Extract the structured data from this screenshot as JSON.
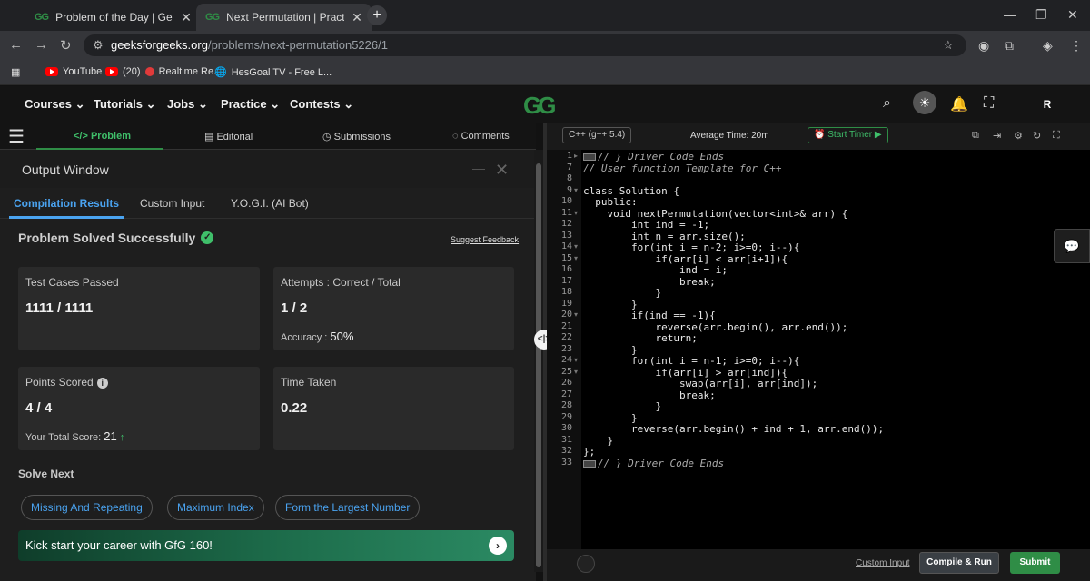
{
  "browser": {
    "tabs": [
      {
        "label": "Problem of the Day | GeeksforG",
        "favicon": "GG"
      },
      {
        "label": "Next Permutation | Practice | Ge",
        "favicon": "GG"
      }
    ],
    "new_tab": "+",
    "url_host": "geeksforgeeks.org",
    "url_path": "/problems/next-permutation5226/1",
    "bookmarks": [
      {
        "label": "YouTube"
      },
      {
        "label": "(20)"
      },
      {
        "label": "Realtime Re..."
      },
      {
        "label": "HesGoal TV - Free L..."
      }
    ]
  },
  "nav": {
    "items": [
      "Courses",
      "Tutorials",
      "Jobs",
      "Practice",
      "Contests"
    ],
    "logo": "GG",
    "avatar": "R"
  },
  "left_tabs": [
    "</> Problem",
    "Editorial",
    "Submissions",
    "Comments"
  ],
  "output": {
    "title": "Output Window",
    "tabs": [
      "Compilation Results",
      "Custom Input",
      "Y.O.G.I. (AI Bot)"
    ],
    "status": "Problem Solved Successfully",
    "feedback": "Suggest Feedback",
    "test_label": "Test Cases Passed",
    "test_value": "1111 / 1111",
    "attempts_label": "Attempts : Correct / Total",
    "attempts_value": "1 / 2",
    "accuracy_label": "Accuracy :",
    "accuracy_value": "50%",
    "points_label": "Points Scored",
    "points_value": "4 / 4",
    "total_label": "Your Total Score:",
    "total_value": "21",
    "time_label": "Time Taken",
    "time_value": "0.22",
    "solve_next": "Solve Next",
    "next_problems": [
      "Missing And Repeating",
      "Maximum Index",
      "Form the Largest Number"
    ],
    "banner": "Kick start your career with GfG 160!"
  },
  "editor": {
    "language": "C++ (g++ 5.4)",
    "avg_time": "Average Time: 20m",
    "timer": "Start Timer",
    "custom_input": "Custom Input",
    "compile": "Compile & Run",
    "submit": "Submit",
    "lines": [
      {
        "n": "1",
        "text": "// } Driver Code Ends",
        "comment": true,
        "folded": true
      },
      {
        "n": "7",
        "text": "// User function Template for C++",
        "comment": true
      },
      {
        "n": "8",
        "text": ""
      },
      {
        "n": "9",
        "text": "class Solution {"
      },
      {
        "n": "10",
        "text": "  public:"
      },
      {
        "n": "11",
        "text": "    void nextPermutation(vector<int>& arr) {"
      },
      {
        "n": "12",
        "text": "        int ind = -1;"
      },
      {
        "n": "13",
        "text": "        int n = arr.size();"
      },
      {
        "n": "14",
        "text": "        for(int i = n-2; i>=0; i--){"
      },
      {
        "n": "15",
        "text": "            if(arr[i] < arr[i+1]){"
      },
      {
        "n": "16",
        "text": "                ind = i;"
      },
      {
        "n": "17",
        "text": "                break;"
      },
      {
        "n": "18",
        "text": "            }"
      },
      {
        "n": "19",
        "text": "        }"
      },
      {
        "n": "20",
        "text": "        if(ind == -1){"
      },
      {
        "n": "21",
        "text": "            reverse(arr.begin(), arr.end());"
      },
      {
        "n": "22",
        "text": "            return;"
      },
      {
        "n": "23",
        "text": "        }"
      },
      {
        "n": "24",
        "text": "        for(int i = n-1; i>=0; i--){"
      },
      {
        "n": "25",
        "text": "            if(arr[i] > arr[ind]){"
      },
      {
        "n": "26",
        "text": "                swap(arr[i], arr[ind]);"
      },
      {
        "n": "27",
        "text": "                break;"
      },
      {
        "n": "28",
        "text": "            }"
      },
      {
        "n": "29",
        "text": "        }"
      },
      {
        "n": "30",
        "text": "        reverse(arr.begin() + ind + 1, arr.end());"
      },
      {
        "n": "31",
        "text": "    }"
      },
      {
        "n": "32",
        "text": "};"
      },
      {
        "n": "33",
        "text": "// } Driver Code Ends",
        "comment": true,
        "folded": true
      }
    ]
  }
}
